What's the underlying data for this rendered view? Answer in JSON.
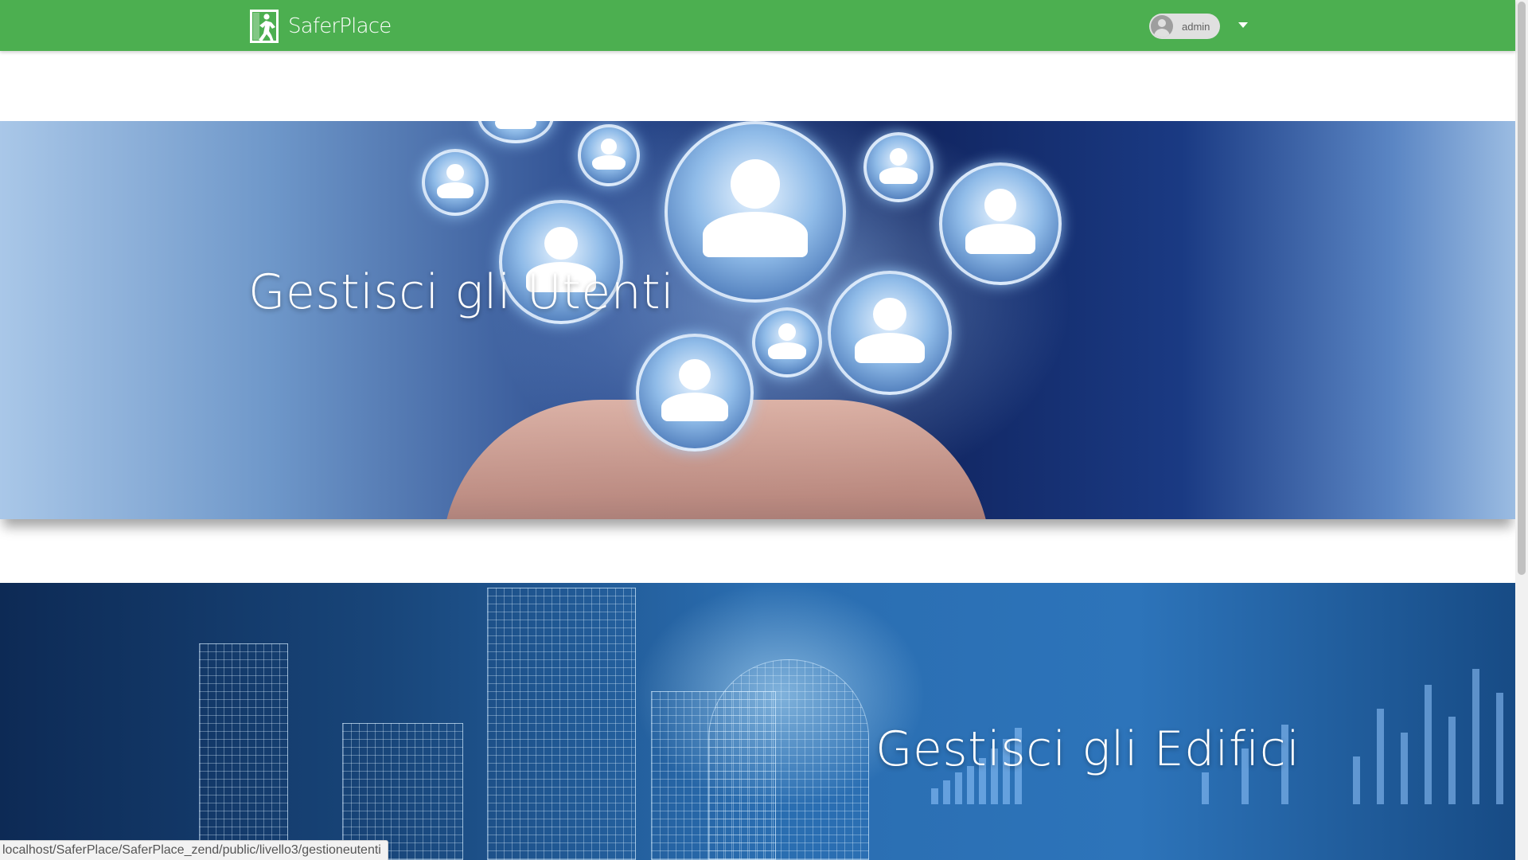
{
  "app": {
    "name": "SaferPlace",
    "brand_color": "#4caf50"
  },
  "header": {
    "logo_icon": "emergency-exit-icon",
    "user_name": "admin",
    "user_icon": "account-circle-icon",
    "menu_icon": "arrow-drop-down-icon"
  },
  "cards": [
    {
      "title": "Gestisci gli Utenti"
    },
    {
      "title": "Gestisci gli Edifici"
    }
  ],
  "status_bar": {
    "url": "localhost/SaferPlace/SaferPlace_zend/public/livello3/gestioneutenti"
  }
}
